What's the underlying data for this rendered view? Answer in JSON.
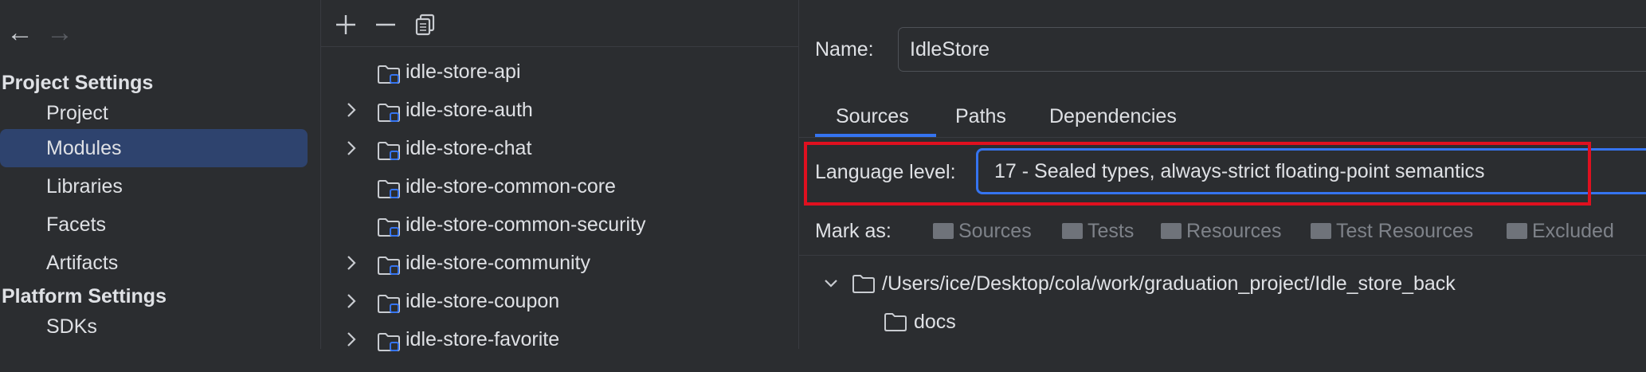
{
  "nav": {
    "back_label": "←",
    "forward_label": "→"
  },
  "sidebar": {
    "project_settings_title": "Project Settings",
    "project_items": [
      {
        "label": "Project"
      },
      {
        "label": "Modules"
      },
      {
        "label": "Libraries"
      },
      {
        "label": "Facets"
      },
      {
        "label": "Artifacts"
      }
    ],
    "platform_settings_title": "Platform Settings",
    "platform_items": [
      {
        "label": "SDKs"
      }
    ],
    "selected": "Modules"
  },
  "toolbar": {
    "add_icon": "plus-icon",
    "remove_icon": "minus-icon",
    "copy_icon": "copy-icon"
  },
  "modules": [
    {
      "label": "idle-store-api",
      "expandable": false
    },
    {
      "label": "idle-store-auth",
      "expandable": true
    },
    {
      "label": "idle-store-chat",
      "expandable": true
    },
    {
      "label": "idle-store-common-core",
      "expandable": false
    },
    {
      "label": "idle-store-common-security",
      "expandable": false
    },
    {
      "label": "idle-store-community",
      "expandable": true
    },
    {
      "label": "idle-store-coupon",
      "expandable": true
    },
    {
      "label": "idle-store-favorite",
      "expandable": true
    }
  ],
  "details": {
    "name_label": "Name:",
    "name_value": "IdleStore",
    "tabs": [
      {
        "label": "Sources"
      },
      {
        "label": "Paths"
      },
      {
        "label": "Dependencies"
      }
    ],
    "active_tab": "Sources",
    "language_level_label": "Language level:",
    "language_level_value": "17 - Sealed types, always-strict floating-point semantics",
    "mark_as_label": "Mark as:",
    "mark_as_buttons": [
      {
        "label": "Sources"
      },
      {
        "label": "Tests"
      },
      {
        "label": "Resources"
      },
      {
        "label": "Test Resources"
      },
      {
        "label": "Excluded"
      }
    ],
    "content_root": "/Users/ice/Desktop/cola/work/graduation_project/Idle_store_back",
    "children": [
      {
        "label": "docs"
      }
    ]
  },
  "colors": {
    "background": "#2b2d30",
    "selection": "#2e436e",
    "accent": "#3574f0",
    "highlight_box": "#e0101f"
  }
}
